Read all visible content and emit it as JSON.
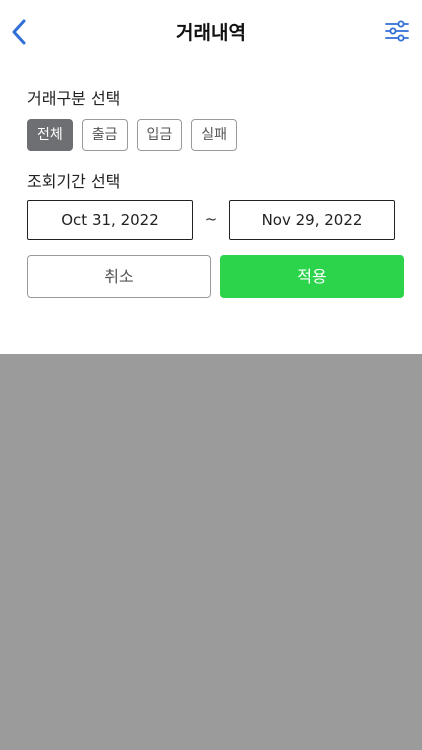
{
  "header": {
    "title": "거래내역",
    "back_icon": "chevron-left-icon",
    "filter_icon": "sliders-icon",
    "accent_color": "#2f6fd6"
  },
  "type_filter": {
    "label": "거래구분 선택",
    "options": [
      "전체",
      "출금",
      "입금",
      "실패"
    ],
    "selected": "전체"
  },
  "period_filter": {
    "label": "조회기간 선택",
    "start_date": "Oct 31, 2022",
    "separator": "~",
    "end_date": "Nov 29, 2022"
  },
  "actions": {
    "cancel_label": "취소",
    "apply_label": "적용",
    "apply_color": "#2bd44b"
  },
  "overlay_color": "#9b9b9b"
}
